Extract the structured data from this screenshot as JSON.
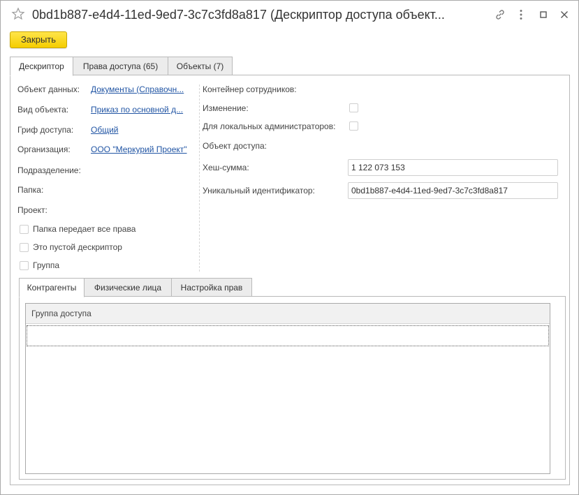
{
  "window": {
    "title": "0bd1b887-e4d4-11ed-9ed7-3c7c3fd8a817 (Дескриптор доступа объект..."
  },
  "toolbar": {
    "close_label": "Закрыть"
  },
  "tabs": [
    {
      "label": "Дескриптор",
      "active": true
    },
    {
      "label": "Права доступа (65)",
      "active": false
    },
    {
      "label": "Объекты (7)",
      "active": false
    }
  ],
  "left": {
    "data_object_label": "Объект данных:",
    "data_object_value": "Документы (Справочн...",
    "object_type_label": "Вид объекта:",
    "object_type_value": "Приказ по основной д...",
    "access_stamp_label": "Гриф доступа:",
    "access_stamp_value": "Общий",
    "organization_label": "Организация:",
    "organization_value": "ООО \"Меркурий Проект\"",
    "department_label": "Подразделение:",
    "folder_label": "Папка:",
    "project_label": "Проект:",
    "folder_passes_rights": "Папка передает все права",
    "empty_descriptor": "Это пустой дескриптор",
    "group": "Группа"
  },
  "right": {
    "employees_container_label": "Контейнер сотрудников:",
    "change_label": "Изменение:",
    "local_admins_label": "Для локальных администраторов:",
    "access_object_label": "Объект доступа:",
    "hash_label": "Хеш-сумма:",
    "hash_value": "1 122 073 153",
    "uid_label": "Уникальный идентификатор:",
    "uid_value": "0bd1b887-e4d4-11ed-9ed7-3c7c3fd8a817"
  },
  "subtabs": [
    {
      "label": "Контрагенты",
      "active": true
    },
    {
      "label": "Физические лица",
      "active": false
    },
    {
      "label": "Настройка прав",
      "active": false
    }
  ],
  "grid": {
    "column_header": "Группа доступа"
  },
  "colors": {
    "accent_button": "#f5cd00",
    "link": "#2155a4"
  }
}
